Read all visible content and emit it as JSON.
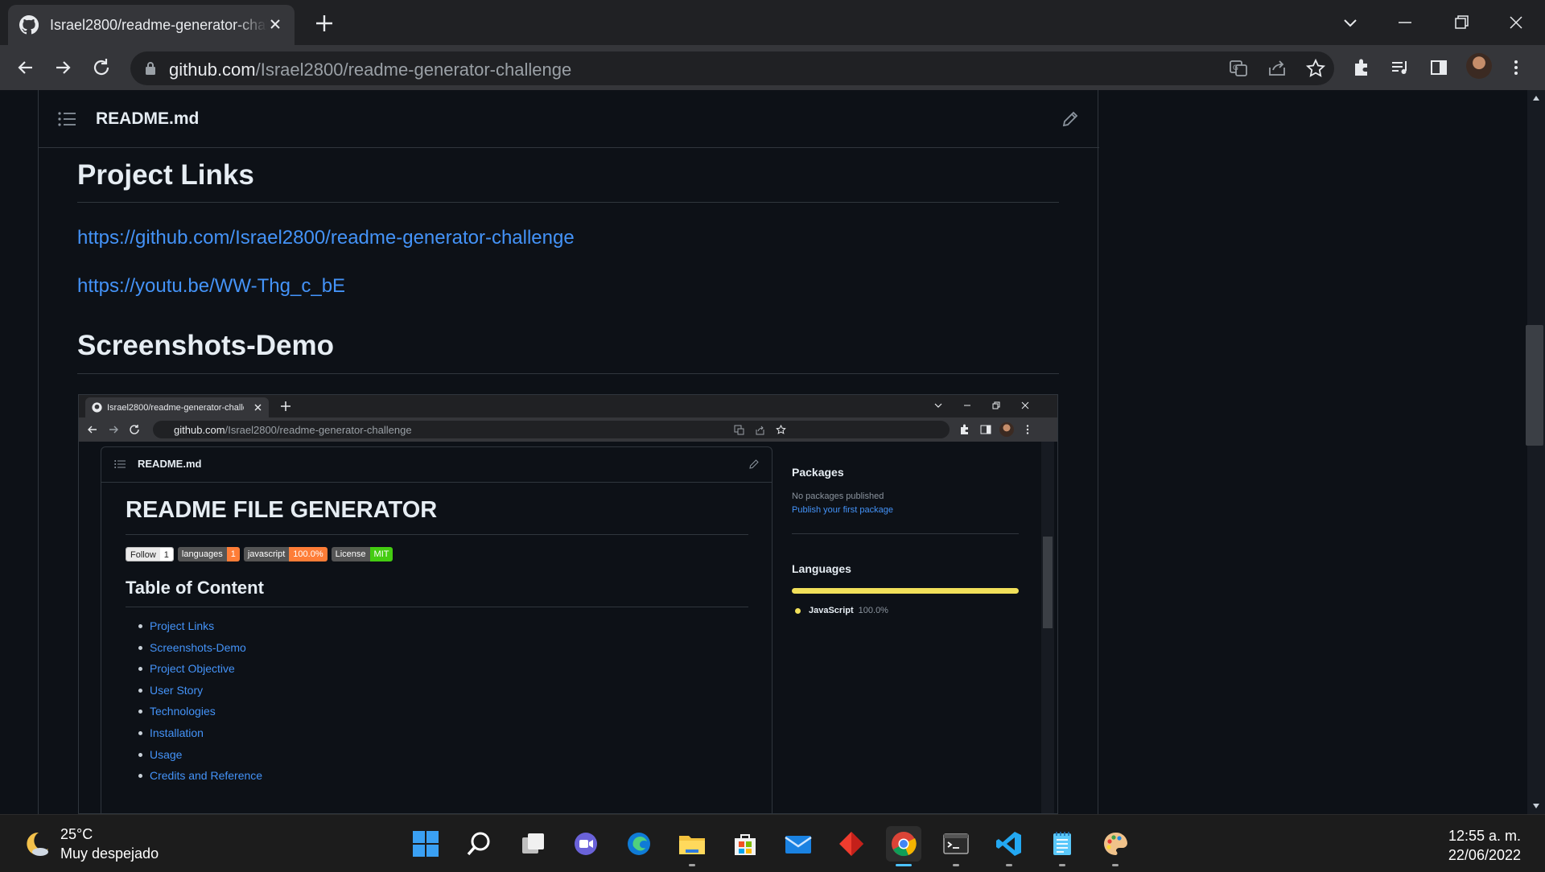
{
  "browser": {
    "tab_title": "Israel2800/readme-generator-challenge",
    "url_host": "github.com",
    "url_path": "/Israel2800/readme-generator-challenge"
  },
  "readme": {
    "file_title": "README.md",
    "sections": {
      "project_links_heading": "Project Links",
      "link_repo": "https://github.com/Israel2800/readme-generator-challenge",
      "link_video": "https://youtu.be/WW-Thg_c_bE",
      "screenshots_heading": "Screenshots-Demo"
    }
  },
  "embedded": {
    "tab_title": "Israel2800/readme-generator-challenge",
    "url_host": "github.com",
    "url_path": "/Israel2800/readme-generator-challenge",
    "file_title": "README.md",
    "h1": "README FILE GENERATOR",
    "badges": [
      {
        "left": "Follow",
        "right": "1"
      },
      {
        "left": "languages",
        "right": "1"
      },
      {
        "left": "javascript",
        "right": "100.0%"
      },
      {
        "left": "License",
        "right": "MIT"
      }
    ],
    "toc_heading": "Table of Content",
    "toc": [
      "Project Links",
      "Screenshots-Demo",
      "Project Objective",
      "User Story",
      "Technologies",
      "Installation",
      "Usage",
      "Credits and Reference"
    ],
    "sidebar": {
      "packages_heading": "Packages",
      "packages_none": "No packages published",
      "packages_link": "Publish your first package",
      "languages_heading": "Languages",
      "language_name": "JavaScript",
      "language_pct": "100.0%",
      "language_share": 1.0
    }
  },
  "taskbar": {
    "temperature": "25°C",
    "weather": "Muy despejado",
    "time": "12:55 a. m.",
    "date": "22/06/2022"
  },
  "colors": {
    "link": "#4493f8",
    "javascript": "#f1e05a",
    "background": "#0d1117"
  }
}
